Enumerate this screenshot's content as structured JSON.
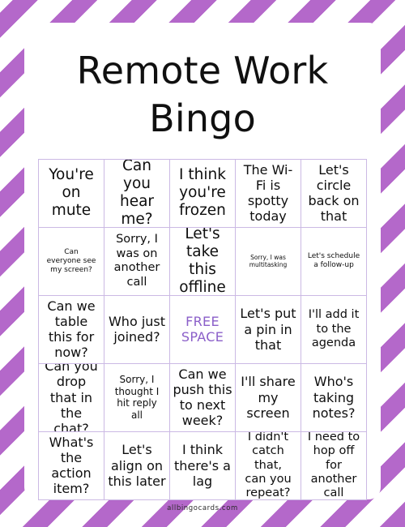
{
  "card": {
    "title": "Remote Work\nBingo",
    "free_space_label": "FREE\nSPACE",
    "free_space_color": "#8b5fc9",
    "accent_color": "#b468ca",
    "grid_line_color": "#cbb9e4",
    "footer": "allbingocards.com",
    "grid": {
      "columns": 5,
      "rows": 5,
      "cells": [
        [
          {
            "text": "You're\non\nmute",
            "size": "fs-xl"
          },
          {
            "text": "Can you\nhear\nme?",
            "size": "fs-xl"
          },
          {
            "text": "I think\nyou're\nfrozen",
            "size": "fs-xl"
          },
          {
            "text": "The Wi-\nFi is\nspotty\ntoday",
            "size": "fs-lg"
          },
          {
            "text": "Let's\ncircle\nback on\nthat",
            "size": "fs-lg"
          }
        ],
        [
          {
            "text": "Can\neveryone see\nmy screen?",
            "size": "fs-xs"
          },
          {
            "text": "Sorry, I\nwas on\nanother\ncall",
            "size": "fs-md"
          },
          {
            "text": "Let's\ntake this\noffline",
            "size": "fs-xl"
          },
          {
            "text": "Sorry, I was\nmultitasking",
            "size": "fs-xxs"
          },
          {
            "text": "Let's schedule\na follow-up",
            "size": "fs-xs"
          }
        ],
        [
          {
            "text": "Can we\ntable\nthis for\nnow?",
            "size": "fs-lg"
          },
          {
            "text": "Who just\njoined?",
            "size": "fs-lg"
          },
          {
            "text": "FREE\nSPACE",
            "size": "free"
          },
          {
            "text": "Let's put\na pin in\nthat",
            "size": "fs-lg"
          },
          {
            "text": "I'll add it\nto the\nagenda",
            "size": "fs-md"
          }
        ],
        [
          {
            "text": "Can you\ndrop\nthat in\nthe chat?",
            "size": "fs-lg"
          },
          {
            "text": "Sorry, I\nthought I\nhit reply\nall",
            "size": "fs-sm"
          },
          {
            "text": "Can we\npush this\nto next\nweek?",
            "size": "fs-lg"
          },
          {
            "text": "I'll share\nmy\nscreen",
            "size": "fs-lg"
          },
          {
            "text": "Who's\ntaking\nnotes?",
            "size": "fs-lg"
          }
        ],
        [
          {
            "text": "What's\nthe\naction\nitem?",
            "size": "fs-lg"
          },
          {
            "text": "Let's\nalign on\nthis later",
            "size": "fs-lg"
          },
          {
            "text": "I think\nthere's a\nlag",
            "size": "fs-lg"
          },
          {
            "text": "I didn't\ncatch that,\ncan you\nrepeat?",
            "size": "fs-md"
          },
          {
            "text": "I need to\nhop off for\nanother\ncall",
            "size": "fs-md"
          }
        ]
      ]
    }
  }
}
